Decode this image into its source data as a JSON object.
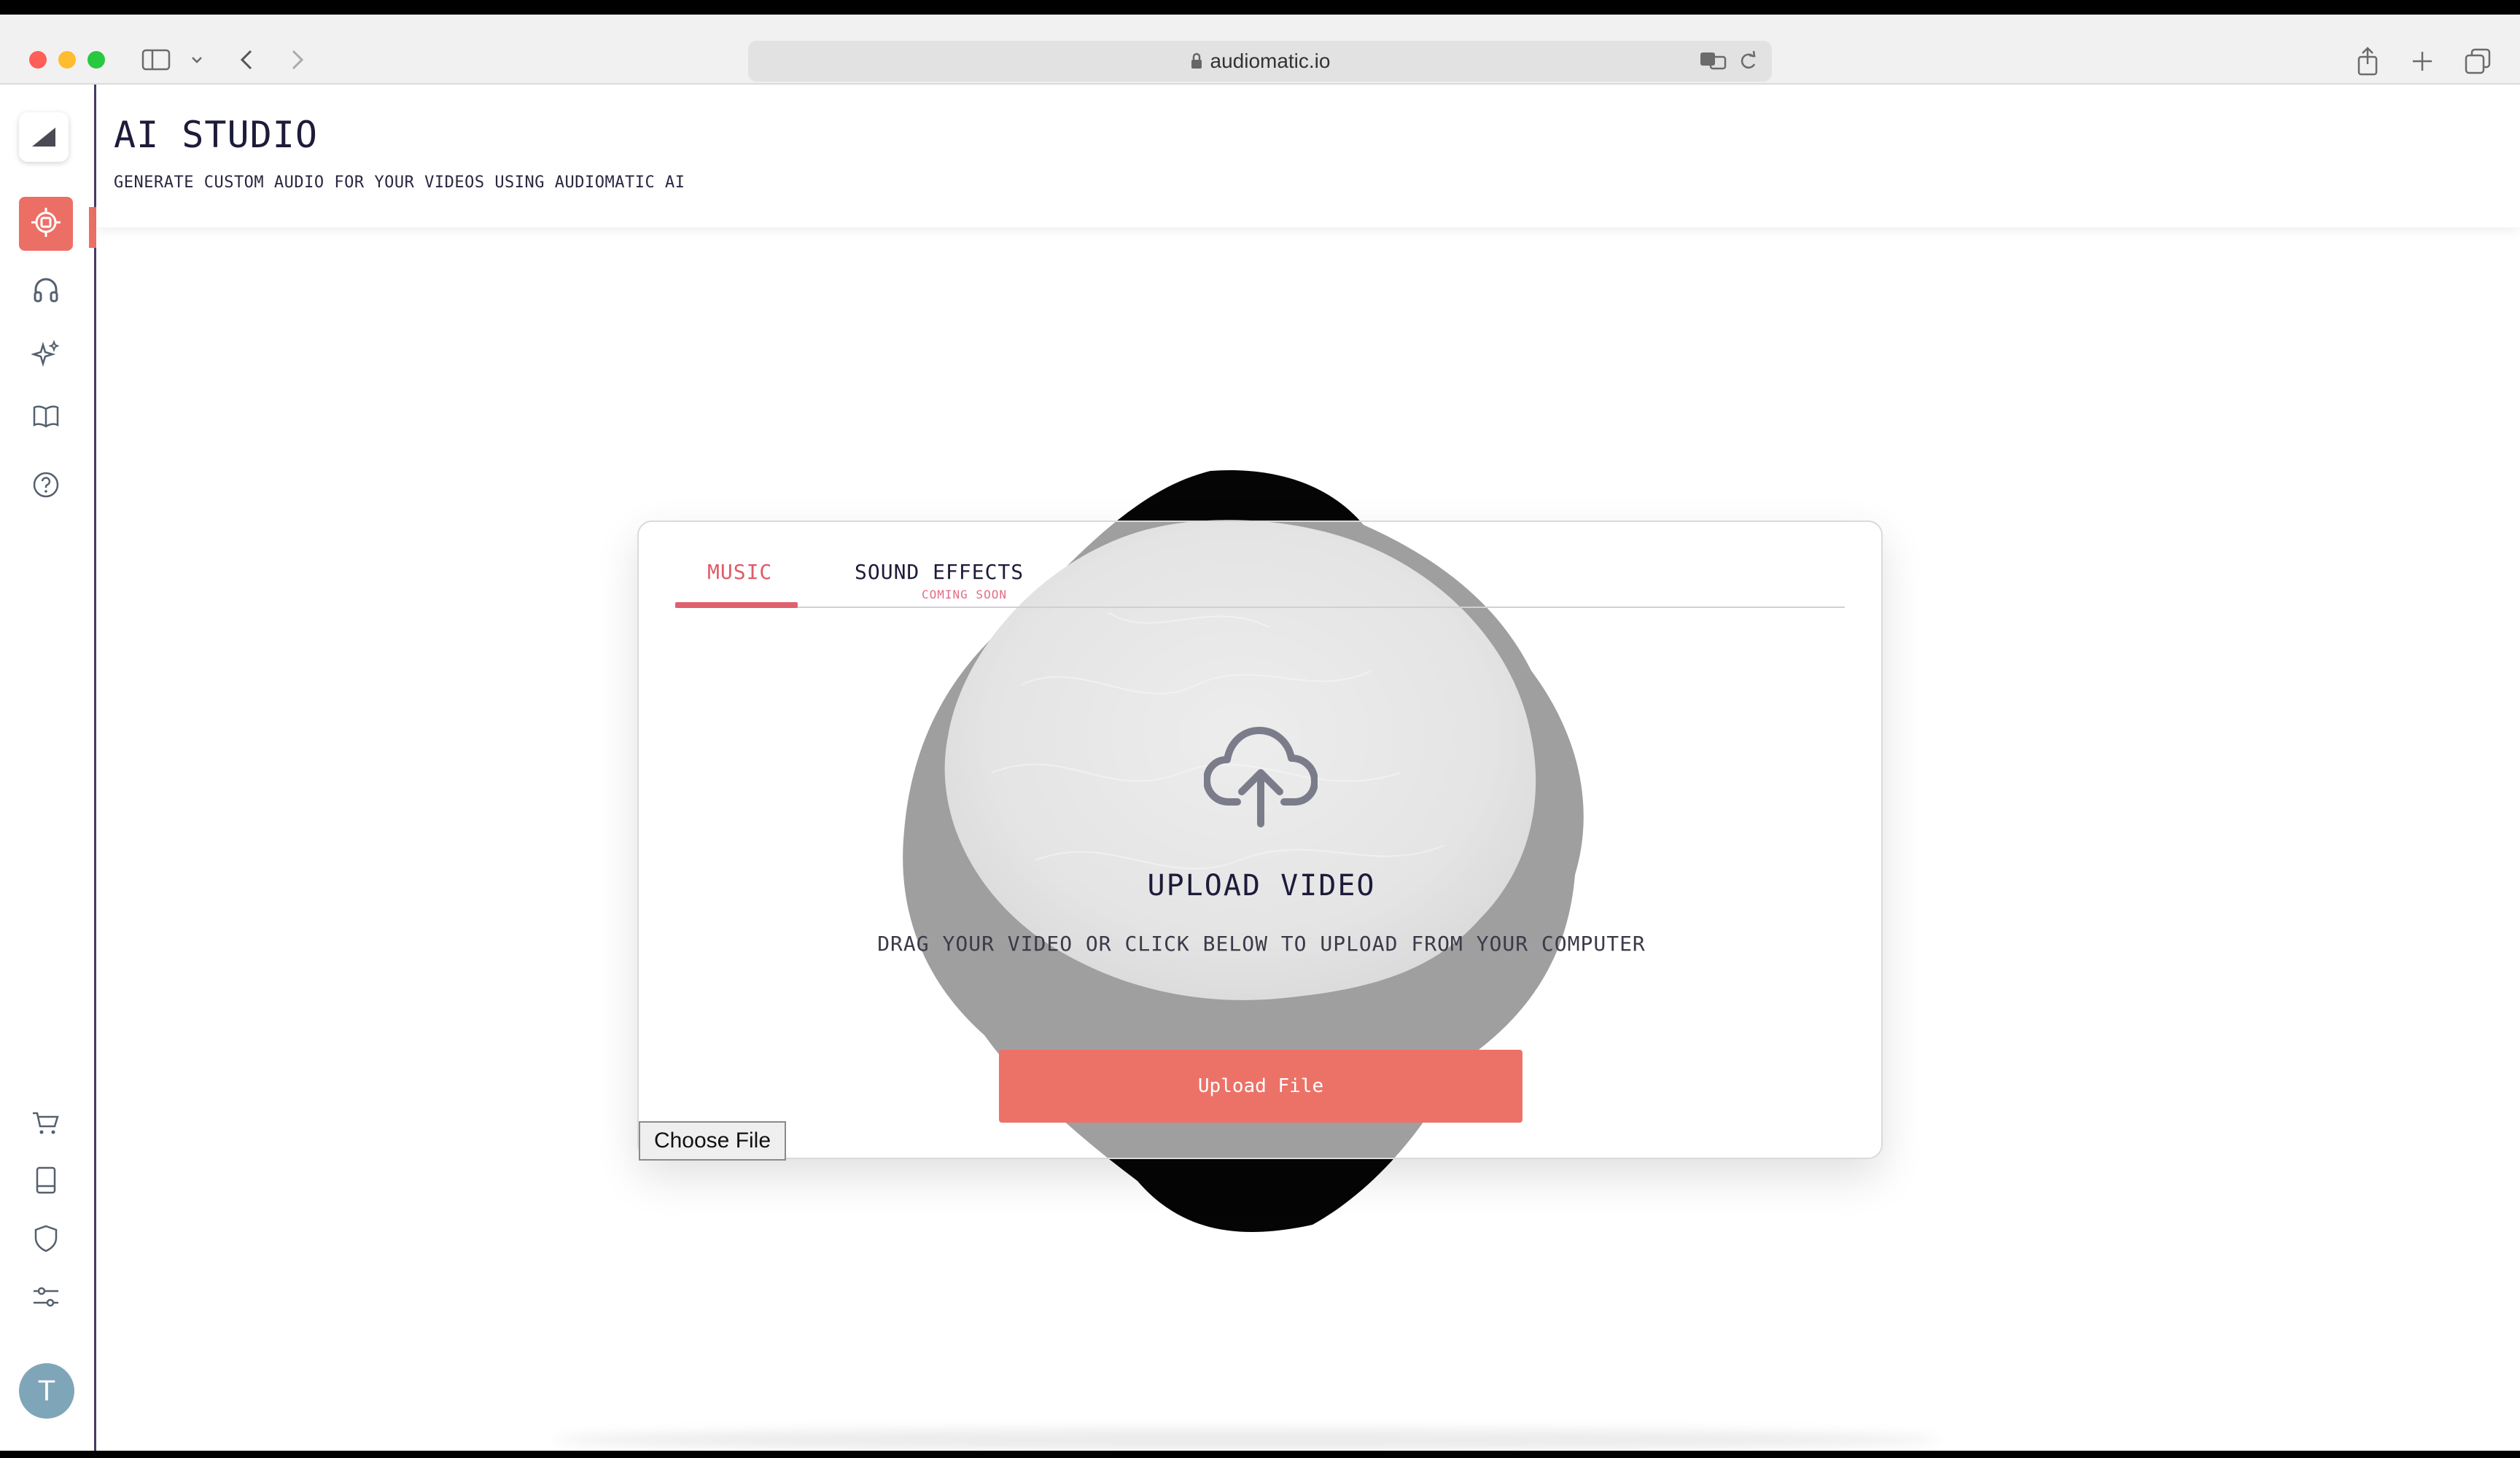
{
  "browser": {
    "url": "audiomatic.io"
  },
  "header": {
    "title": "AI STUDIO",
    "subtitle": "GENERATE CUSTOM AUDIO FOR YOUR VIDEOS USING AUDIOMATIC AI"
  },
  "sidebar": {
    "items": [
      {
        "icon": "ai-chip-icon",
        "active": true
      },
      {
        "icon": "headphones-icon",
        "active": false
      },
      {
        "icon": "sparkles-icon",
        "active": false
      },
      {
        "icon": "book-icon",
        "active": false
      },
      {
        "icon": "help-icon",
        "active": false
      }
    ],
    "bottom_items": [
      {
        "icon": "cart-icon"
      },
      {
        "icon": "notebook-icon"
      },
      {
        "icon": "shield-icon"
      },
      {
        "icon": "sliders-icon"
      }
    ],
    "avatar_initial": "T"
  },
  "card": {
    "tabs": [
      {
        "label": "MUSIC",
        "active": true
      },
      {
        "label": "SOUND EFFECTS",
        "badge": "COMING SOON",
        "active": false
      }
    ],
    "upload_title": "UPLOAD VIDEO",
    "upload_description": "DRAG YOUR VIDEO OR CLICK BELOW TO UPLOAD FROM YOUR COMPUTER",
    "upload_button": "Upload File",
    "choose_file": "Choose File"
  },
  "colors": {
    "accent": "#ec6f66",
    "tab_active": "#e05a68",
    "text_dark": "#1d1b3a"
  }
}
